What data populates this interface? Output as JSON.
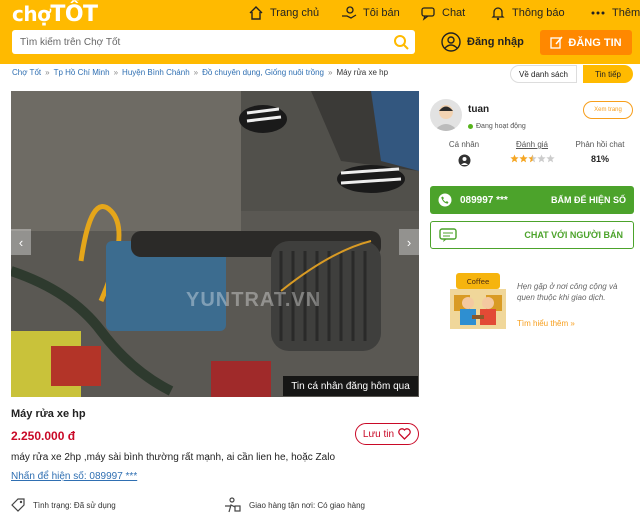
{
  "header": {
    "logo": {
      "part1": "chợ",
      "part2": "TỐT"
    },
    "nav": [
      {
        "label": "Trang chủ",
        "icon": "home-icon"
      },
      {
        "label": "Tôi bán",
        "icon": "hand-coin-icon"
      },
      {
        "label": "Chat",
        "icon": "chat-icon"
      },
      {
        "label": "Thông báo",
        "icon": "bell-icon"
      },
      {
        "label": "Thêm",
        "icon": "more-icon"
      }
    ],
    "search_placeholder": "Tìm kiếm trên Chợ Tốt",
    "login_label": "Đăng nhập",
    "post_label": "ĐĂNG TIN",
    "brand_color": "#ffba00",
    "post_color": "#ff8800"
  },
  "breadcrumb": {
    "items": [
      "Chợ Tốt",
      "Tp Hồ Chí Minh",
      "Huyện Bình Chánh",
      "Đồ chuyên dụng, Giống nuôi trồng",
      "Máy rửa xe hp"
    ],
    "back_label": "Về danh sách",
    "next_label": "Tin tiếp"
  },
  "listing": {
    "photo_caption": "Tin cá nhân đăng hôm qua",
    "watermark": "YUNTRAT.VN",
    "title": "Máy rửa xe hp",
    "price": "2.250.000 đ",
    "save_label": "Lưu tin",
    "description": "máy rửa xe 2hp ,máy sài bình thường rất mạnh, ai cần lien he, hoặc Zalo",
    "phone_link": "Nhấn để hiện số: 089997 ***",
    "properties": [
      {
        "label": "Tình trạng: Đã sử dụng",
        "icon": "tag-icon"
      },
      {
        "label": "Giao hàng tận nơi: Có giao hàng",
        "icon": "delivery-icon"
      }
    ],
    "price_color": "#c90927"
  },
  "seller": {
    "name": "tuan",
    "status": "Đang hoạt động",
    "view_label": "Xem trang",
    "stats": [
      {
        "label": "Cá nhân",
        "value": ""
      },
      {
        "label": "Đánh giá",
        "value": "",
        "rating": 2.5
      },
      {
        "label": "Phản hồi chat",
        "value": "81%"
      }
    ],
    "phone_partial": "089997 ***",
    "reveal_label": "BẤM ĐỂ HIỆN SỐ",
    "chat_label": "CHAT VỚI NGƯỜI BÁN",
    "green": "#4ca32b"
  },
  "promo": {
    "text": "Hẹn gặp ở nơi công cộng và quen thuộc khi giao dịch.",
    "link": "Tìm hiểu thêm »",
    "sign_text": "Coffee"
  }
}
